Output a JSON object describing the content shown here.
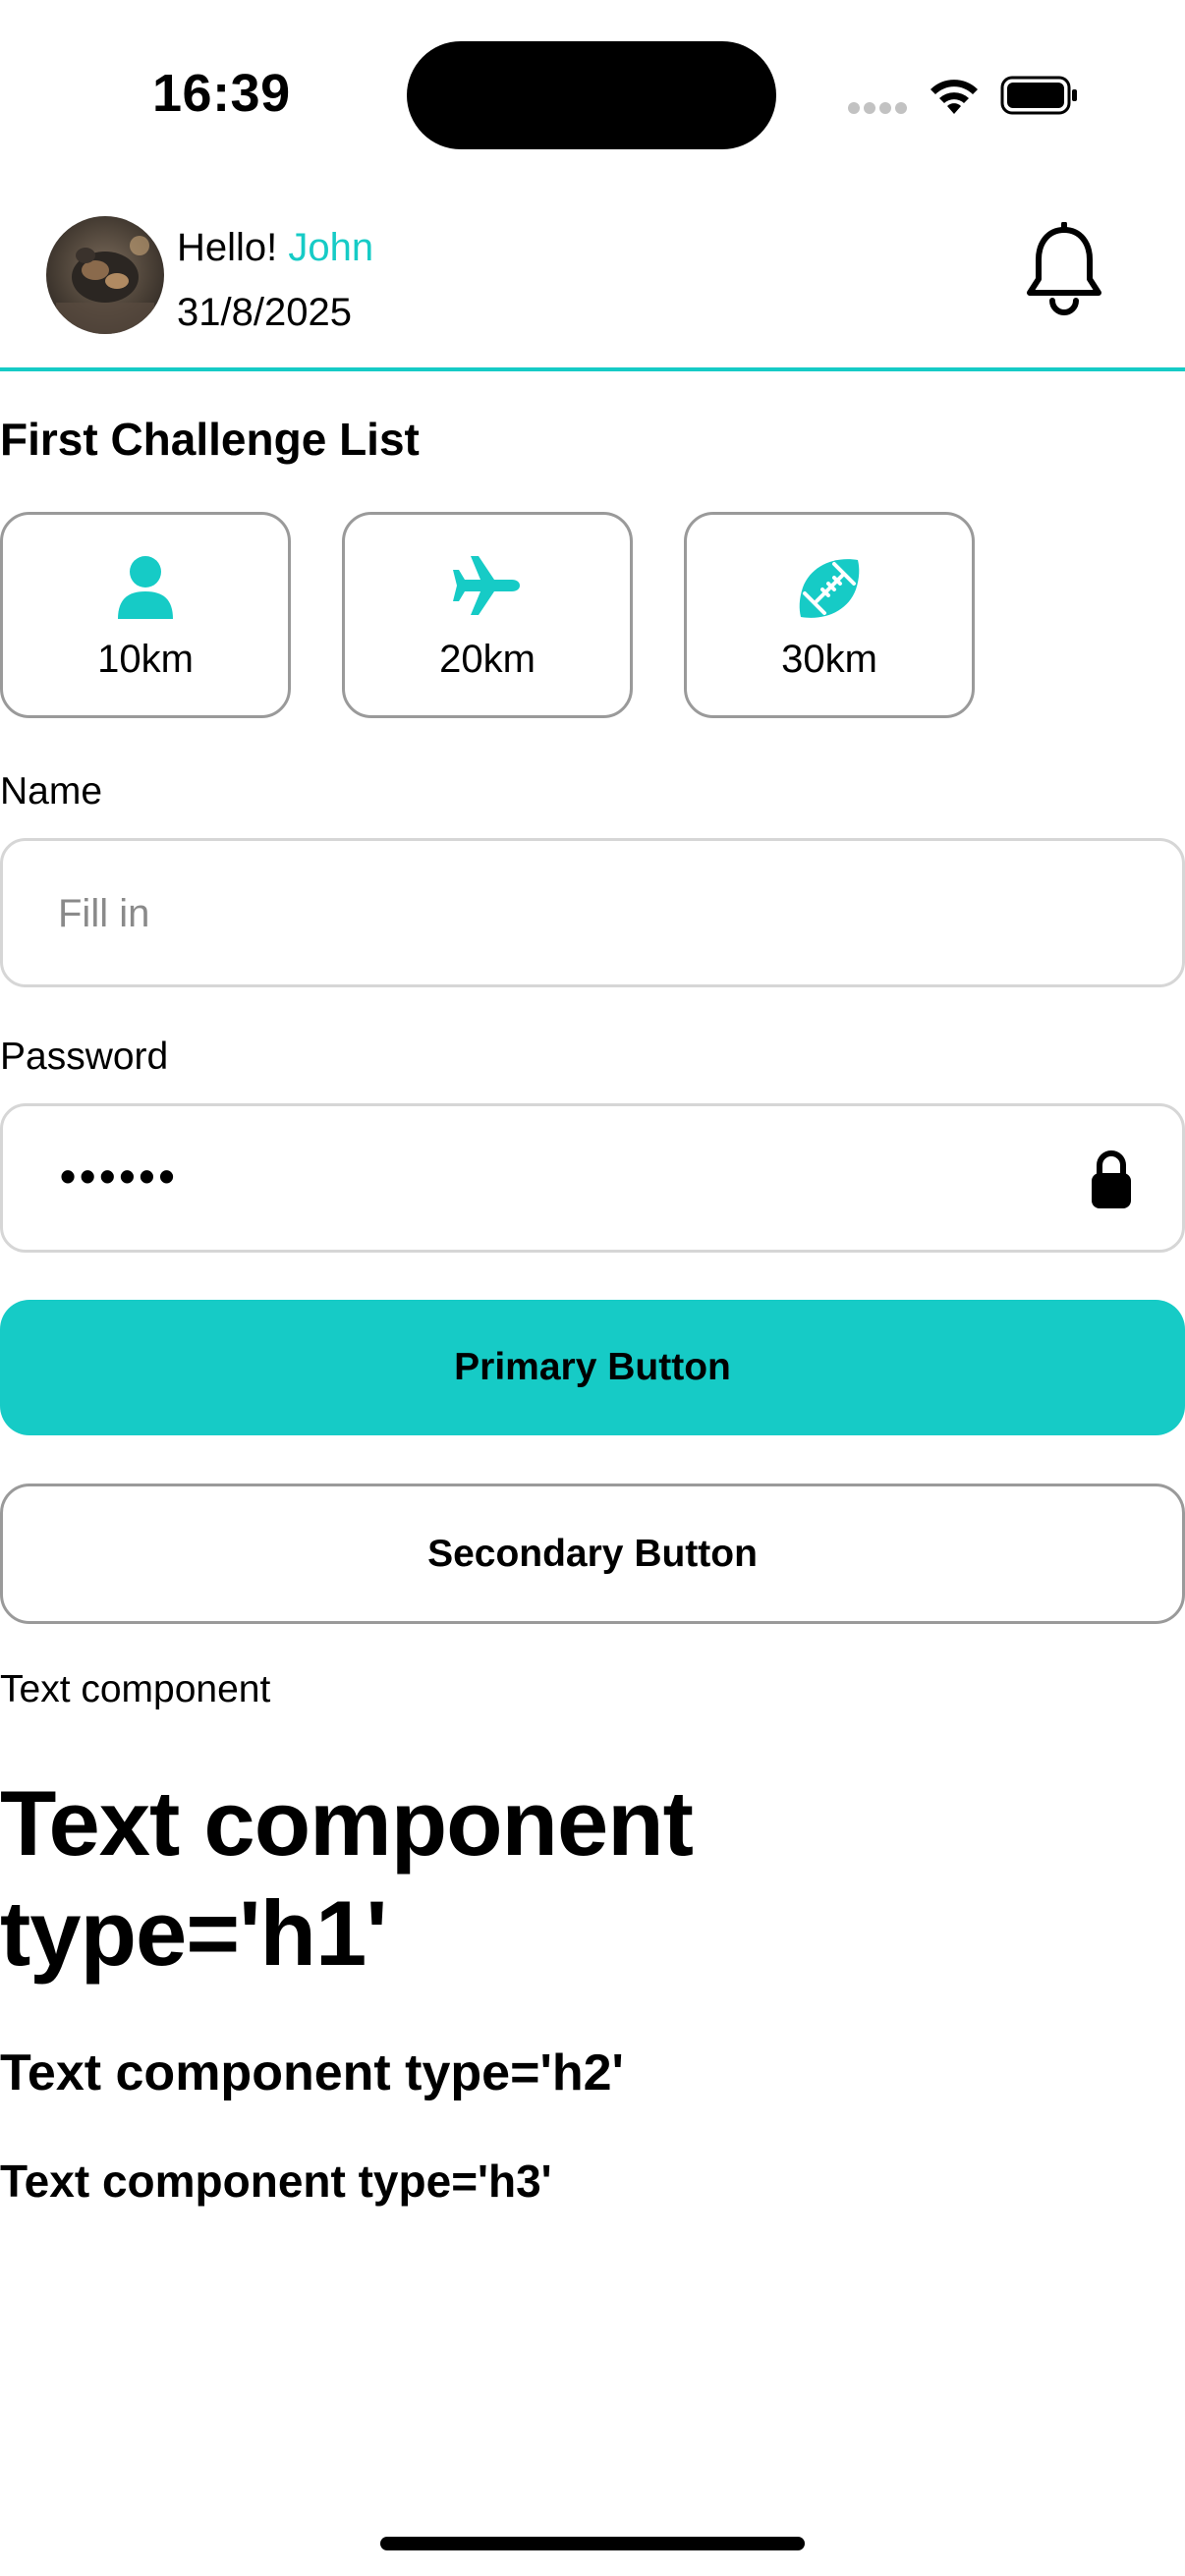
{
  "status_bar": {
    "time": "16:39"
  },
  "header": {
    "greeting_prefix": "Hello!",
    "user_name": "John",
    "date": "31/8/2025"
  },
  "challenges": {
    "title": "First Challenge List",
    "items": [
      {
        "icon": "person-icon",
        "label": "10km"
      },
      {
        "icon": "airplane-icon",
        "label": "20km"
      },
      {
        "icon": "football-icon",
        "label": "30km"
      }
    ]
  },
  "form": {
    "name_label": "Name",
    "name_placeholder": "Fill in",
    "name_value": "",
    "password_label": "Password",
    "password_masked": "••••••"
  },
  "buttons": {
    "primary_label": "Primary Button",
    "secondary_label": "Secondary Button"
  },
  "text_components": {
    "plain": "Text component",
    "h1": "Text component type='h1'",
    "h2": "Text component type='h2'",
    "h3": "Text component type='h3'"
  },
  "colors": {
    "accent": "#16cbc6",
    "border": "#9a9a9a",
    "input_border": "#d6d6d6",
    "placeholder": "#8a8a8a"
  }
}
